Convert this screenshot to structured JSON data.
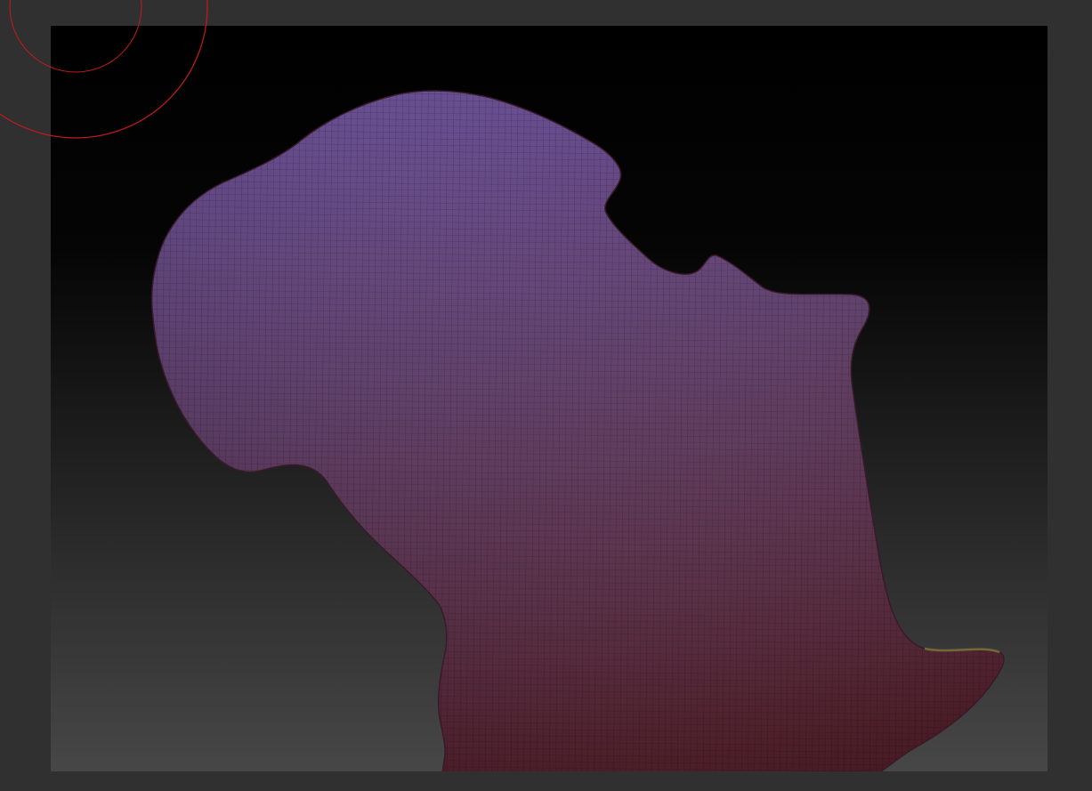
{
  "window": {
    "frame_color": "#303030"
  },
  "viewport": {
    "background_top": "#000000",
    "background_bottom": "#474747"
  },
  "model": {
    "shape": "michigan-lower-peninsula-mesh",
    "color_top": "#5a3f8c",
    "color_bottom": "#5a1e2a",
    "wireframe": true,
    "edge_accent": "#8a8a3a"
  },
  "brush": {
    "icon": "brush-cursor-icon",
    "color": "#c8191e"
  }
}
